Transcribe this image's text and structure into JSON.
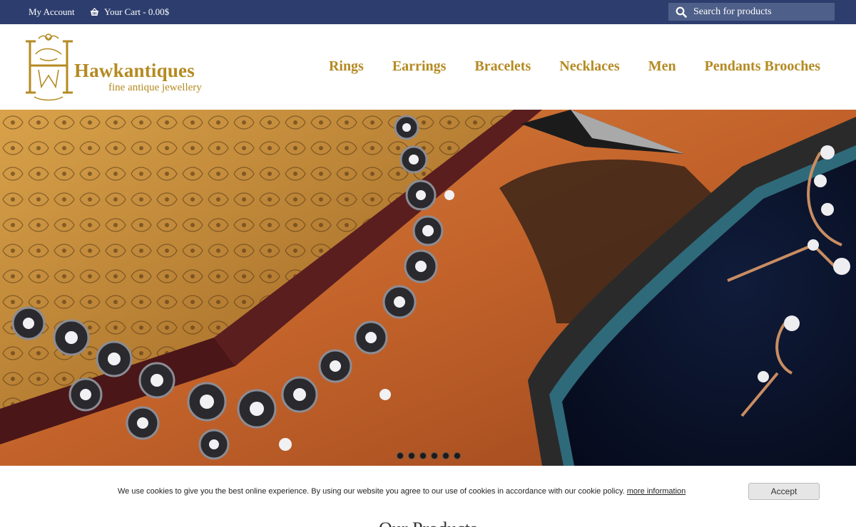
{
  "topbar": {
    "account_label": "My Account",
    "cart_label": "Your Cart - 0.00$",
    "search_placeholder": "Search for products"
  },
  "logo": {
    "name": "Hawkantiques",
    "tagline": "fine antique jewellery"
  },
  "nav": {
    "items": [
      {
        "label": "Rings"
      },
      {
        "label": "Earrings"
      },
      {
        "label": "Bracelets"
      },
      {
        "label": "Necklaces"
      },
      {
        "label": "Men"
      },
      {
        "label": "Pendants Brooches"
      }
    ]
  },
  "hero": {
    "slide_count": 6,
    "active_slide": 1
  },
  "cookie": {
    "message": "We use cookies to give you the best online experience. By using our website you agree to our use of cookies in accordance with our cookie policy.",
    "link_label": "more information",
    "accept_label": "Accept"
  },
  "main": {
    "section_title": "Our Products"
  },
  "colors": {
    "topbar": "#2d3e6e",
    "gold": "#b48a22",
    "search_bg": "#4e5f89"
  }
}
